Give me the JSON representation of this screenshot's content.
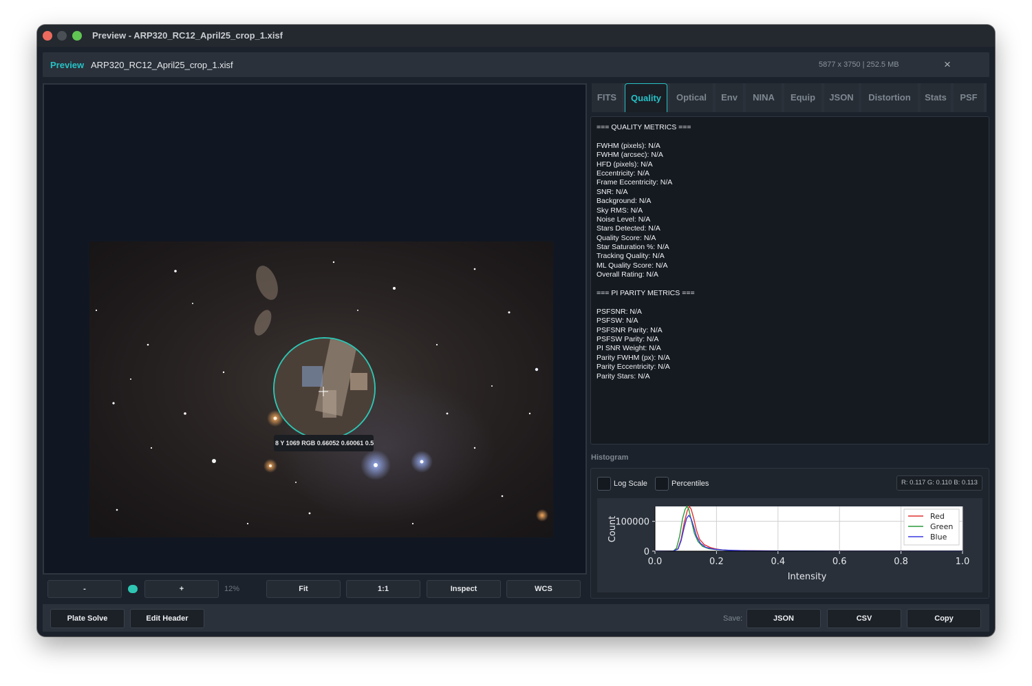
{
  "window": {
    "title": "Preview - ARP320_RC12_April25_crop_1.xisf"
  },
  "header": {
    "label": "Preview",
    "filename": "ARP320_RC12_April25_crop_1.xisf",
    "size_info": "5877 x 3750 | 252.5 MB",
    "close_glyph": "×"
  },
  "viewer": {
    "pixel_readout": "8   Y 1069   RGB 0.66052 0.60061 0.5",
    "zoom": {
      "minus_label": "-",
      "plus_label": "+",
      "percent": "12%",
      "fit_label": "Fit",
      "one_to_one_label": "1:1",
      "inspect_label": "Inspect",
      "wcs_label": "WCS"
    }
  },
  "tabs": [
    {
      "label": "FITS",
      "active": false
    },
    {
      "label": "Quality",
      "active": true
    },
    {
      "label": "Optical",
      "active": false
    },
    {
      "label": "Env",
      "active": false
    },
    {
      "label": "NINA",
      "active": false
    },
    {
      "label": "Equip",
      "active": false
    },
    {
      "label": "JSON",
      "active": false
    },
    {
      "label": "Distortion",
      "active": false
    },
    {
      "label": "Stats",
      "active": false
    },
    {
      "label": "PSF",
      "active": false
    }
  ],
  "metrics": {
    "lines": [
      "=== QUALITY METRICS ===",
      "",
      "FWHM (pixels): N/A",
      "FWHM (arcsec): N/A",
      "HFD (pixels): N/A",
      "Eccentricity: N/A",
      "Frame Eccentricity: N/A",
      "SNR: N/A",
      "Background: N/A",
      "Sky RMS: N/A",
      "Noise Level: N/A",
      "Stars Detected: N/A",
      "Quality Score: N/A",
      "Star Saturation %: N/A",
      "Tracking Quality: N/A",
      "ML Quality Score: N/A",
      "Overall Rating: N/A",
      "",
      "=== PI PARITY METRICS ===",
      "",
      "PSFSNR: N/A",
      "PSFSW: N/A",
      "PSFSNR Parity: N/A",
      "PSFSW Parity: N/A",
      "PI SNR Weight: N/A",
      "Parity FWHM (px): N/A",
      "Parity Eccentricity: N/A",
      "Parity Stars: N/A"
    ]
  },
  "histogram": {
    "section_label": "Histogram",
    "log_scale_label": "Log Scale",
    "percentiles_label": "Percentiles",
    "rgb_values": "R: 0.117  G: 0.110  B: 0.113"
  },
  "chart_data": {
    "type": "line",
    "xlabel": "Intensity",
    "ylabel": "Count",
    "xlim": [
      0,
      1
    ],
    "ylim": [
      0,
      150000
    ],
    "xticks": [
      "0.0",
      "0.2",
      "0.4",
      "0.6",
      "0.8",
      "1.0"
    ],
    "yticks": [
      "0",
      "100000"
    ],
    "legend_position": "top-right",
    "grid": true,
    "series": [
      {
        "name": "Red",
        "color": "#e03030",
        "x": [
          0.0,
          0.06,
          0.075,
          0.085,
          0.095,
          0.105,
          0.112,
          0.118,
          0.126,
          0.135,
          0.145,
          0.16,
          0.18,
          0.2,
          0.22,
          0.25,
          0.3,
          0.4,
          0.6,
          1.0
        ],
        "y": [
          0,
          500,
          8000,
          40000,
          95000,
          135000,
          150000,
          140000,
          110000,
          70000,
          40000,
          22000,
          12000,
          7000,
          4000,
          2500,
          1500,
          600,
          200,
          0
        ]
      },
      {
        "name": "Green",
        "color": "#2a9a3a",
        "x": [
          0.0,
          0.06,
          0.07,
          0.08,
          0.09,
          0.098,
          0.104,
          0.11,
          0.118,
          0.128,
          0.14,
          0.155,
          0.175,
          0.2,
          0.25,
          0.3,
          0.4,
          0.6,
          1.0
        ],
        "y": [
          0,
          500,
          10000,
          50000,
          110000,
          140000,
          150000,
          140000,
          105000,
          60000,
          32000,
          16000,
          8000,
          5000,
          2000,
          1000,
          500,
          150,
          0
        ]
      },
      {
        "name": "Blue",
        "color": "#3a3ae0",
        "x": [
          0.0,
          0.06,
          0.075,
          0.085,
          0.095,
          0.103,
          0.11,
          0.117,
          0.125,
          0.135,
          0.148,
          0.165,
          0.19,
          0.22,
          0.26,
          0.3,
          0.4,
          0.6,
          1.0
        ],
        "y": [
          0,
          400,
          7000,
          35000,
          80000,
          110000,
          120000,
          110000,
          85000,
          50000,
          26000,
          13000,
          7000,
          4000,
          2200,
          1200,
          500,
          150,
          0
        ]
      }
    ]
  },
  "footer": {
    "plate_solve_label": "Plate Solve",
    "edit_header_label": "Edit Header",
    "save_label": "Save:",
    "json_label": "JSON",
    "csv_label": "CSV",
    "copy_label": "Copy"
  },
  "colors": {
    "accent": "#27c2c6",
    "loupe_ring": "#2ec5b3",
    "window_bg": "#1c222b"
  }
}
